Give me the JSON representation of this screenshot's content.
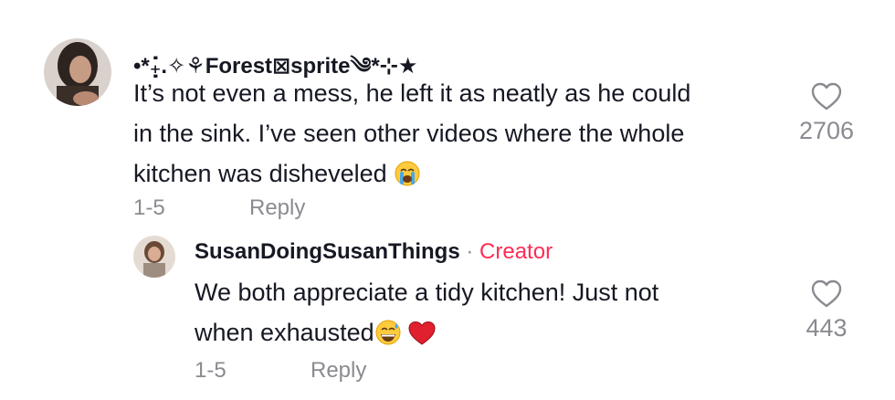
{
  "comments": [
    {
      "username": "•*₊̣̇.✧⚘Forest⊠sprite༄*⊹★",
      "text_line1": "It’s not even a mess, he left it as neatly as he could",
      "text_line2": "in the sink. I’ve seen other videos where the whole",
      "text_line3": "kitchen was disheveled",
      "emoji": "loudly-crying-face",
      "date": "1-5",
      "reply_label": "Reply",
      "likes": "2706"
    }
  ],
  "replies": [
    {
      "username": "SusanDoingSusanThings",
      "separator": "·",
      "badge": "Creator",
      "text_line1": "We both appreciate a tidy kitchen! Just not",
      "text_line2": "when exhausted",
      "emojis": [
        "grinning-sweat-face",
        "red-heart"
      ],
      "date": "1-5",
      "reply_label": "Reply",
      "likes": "443"
    }
  ],
  "colors": {
    "accent_creator": "#fe2c55",
    "muted": "#8a8b91",
    "text": "#161823"
  }
}
